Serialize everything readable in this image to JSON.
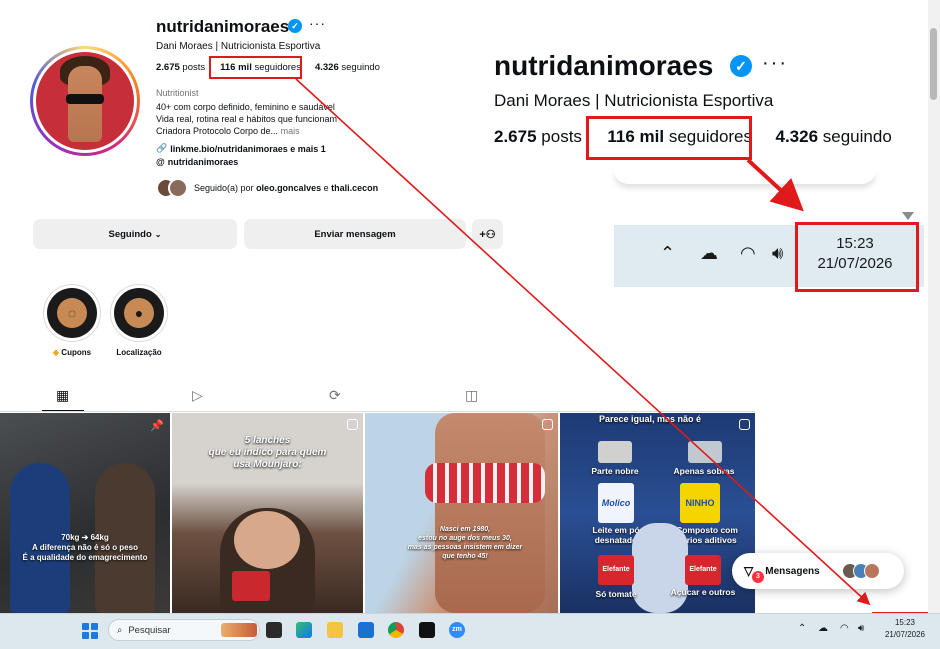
{
  "profile": {
    "username": "nutridanimoraes",
    "full_name": "Dani Moraes | Nutricionista Esportiva",
    "posts_count": "2.675",
    "posts_label": "posts",
    "followers_count": "116 mil",
    "followers_label": "seguidores",
    "following_count": "4.326",
    "following_label": "seguindo",
    "category": "Nutritionist",
    "bio_line1": "40+ com corpo definido, feminino e saudável",
    "bio_line2": "Vida real, rotina real e hábitos que funcionam",
    "bio_line3": "Criadora Protocolo Corpo de...",
    "bio_more": "mais",
    "link": "linkme.bio/nutridanimoraes e mais 1",
    "threads": "nutridanimoraes",
    "followed_by_prefix": "Seguido(a) por",
    "followed_by_1": "oleo.goncalves",
    "followed_by_and": "e",
    "followed_by_2": "thali.cecon"
  },
  "actions": {
    "following_button": "Seguindo",
    "message_button": "Enviar mensagem"
  },
  "highlights": [
    {
      "label": "Cupons",
      "icon": "chat-bubble-icon"
    },
    {
      "label": "Localização",
      "icon": "location-pin-icon"
    }
  ],
  "posts": {
    "post1_caption_line1": "70kg ➔ 64kg",
    "post1_caption_line2": "A diferença não é só o peso",
    "post1_caption_line3": "É a qualidade do emagrecimento",
    "post2_title_line1": "5 lanches",
    "post2_title_line2": "que eu indico para quem",
    "post2_title_line3": "usa Mounjaro:",
    "post3_line1": "Nasci em 1980,",
    "post3_line2": "estou no auge dos meus 30,",
    "post3_line3": "mas as pessoas insistem em dizer",
    "post3_line4": "que tenho 45!",
    "post4_title": "Parece igual, mas não é",
    "post4_items": [
      "Parte nobre",
      "Apenas sobras",
      "Leite em pó desnatado",
      "Composto com vários aditivos",
      "Só tomate",
      "Açúcar e outros"
    ],
    "post4_brand1": "Molico",
    "post4_brand2": "NINHO",
    "post4_brand3": "Elefante",
    "post4_brand4": "Elefante"
  },
  "messages": {
    "label": "Mensagens",
    "badge": "3"
  },
  "zoom": {
    "username": "nutridanimoraes",
    "full_name": "Dani Moraes | Nutricionista Esportiva",
    "posts_count": "2.675",
    "posts_label": "posts",
    "followers_count": "116 mil",
    "followers_label": "seguidores",
    "following_count": "4.326",
    "following_label": "seguindo",
    "time": "15:23",
    "date": "21/07/2026"
  },
  "taskbar": {
    "search_placeholder": "Pesquisar",
    "time": "15:23",
    "date": "21/07/2026",
    "apps": [
      "file-explorer-icon",
      "edge-icon",
      "folder-icon",
      "outlook-icon",
      "chrome-icon",
      "capcut-icon",
      "zoom-icon"
    ]
  },
  "colors": {
    "annotation_red": "#e0191b",
    "verified_blue": "#0095f6",
    "button_gray": "#efefef",
    "taskbar": "#dde8ee"
  }
}
